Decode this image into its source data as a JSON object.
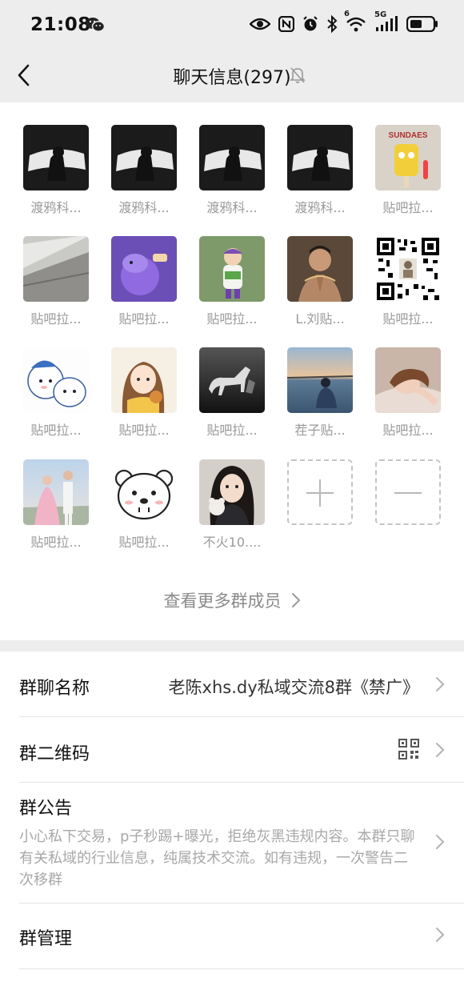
{
  "status_bar": {
    "time": "21:08",
    "network": "5G",
    "wifi_badge": "6"
  },
  "nav": {
    "title": "聊天信息(297)"
  },
  "members": [
    {
      "name": "渡鸦科...",
      "avatar": "window-silhouette"
    },
    {
      "name": "渡鸦科...",
      "avatar": "window-silhouette"
    },
    {
      "name": "渡鸦科...",
      "avatar": "window-silhouette"
    },
    {
      "name": "渡鸦科...",
      "avatar": "window-silhouette"
    },
    {
      "name": "贴吧拉...",
      "avatar": "sundaes-sponge",
      "image_text": "SUNDAES"
    },
    {
      "name": "贴吧拉...",
      "avatar": "architecture"
    },
    {
      "name": "贴吧拉...",
      "avatar": "purple-cartoon"
    },
    {
      "name": "贴吧拉...",
      "avatar": "toy-figure"
    },
    {
      "name": "L.刘贴...",
      "avatar": "man-praying"
    },
    {
      "name": "贴吧拉...",
      "avatar": "qr-code"
    },
    {
      "name": "贴吧拉...",
      "avatar": "cartoon-dogs"
    },
    {
      "name": "贴吧拉...",
      "avatar": "anime-girl"
    },
    {
      "name": "贴吧拉...",
      "avatar": "horse-bw"
    },
    {
      "name": "茬子贴...",
      "avatar": "sea-sunset"
    },
    {
      "name": "贴吧拉...",
      "avatar": "sleeping-girl"
    },
    {
      "name": "贴吧拉...",
      "avatar": "wedding-couple"
    },
    {
      "name": "贴吧拉...",
      "avatar": "bear-face"
    },
    {
      "name": "不火10....",
      "avatar": "girl-with-teddy"
    }
  ],
  "add_member_icon": "plus-icon",
  "remove_member_icon": "minus-icon",
  "more_members_label": "查看更多群成员",
  "settings": {
    "group_name_label": "群聊名称",
    "group_name_value": "老陈xhs.dy私域交流8群《禁广》",
    "qr_label": "群二维码",
    "notice_label": "群公告",
    "notice_text": "小心私下交易，p子秒踢+曝光，拒绝灰黑违规内容。本群只聊有关私域的行业信息，纯属技术交流。如有违规，一次警告二次移群",
    "manage_label": "群管理"
  },
  "colors": {
    "background": "#ededed",
    "panel": "#ffffff",
    "secondary_text": "#9a9a9a",
    "notice_text": "#a8a8a8"
  }
}
